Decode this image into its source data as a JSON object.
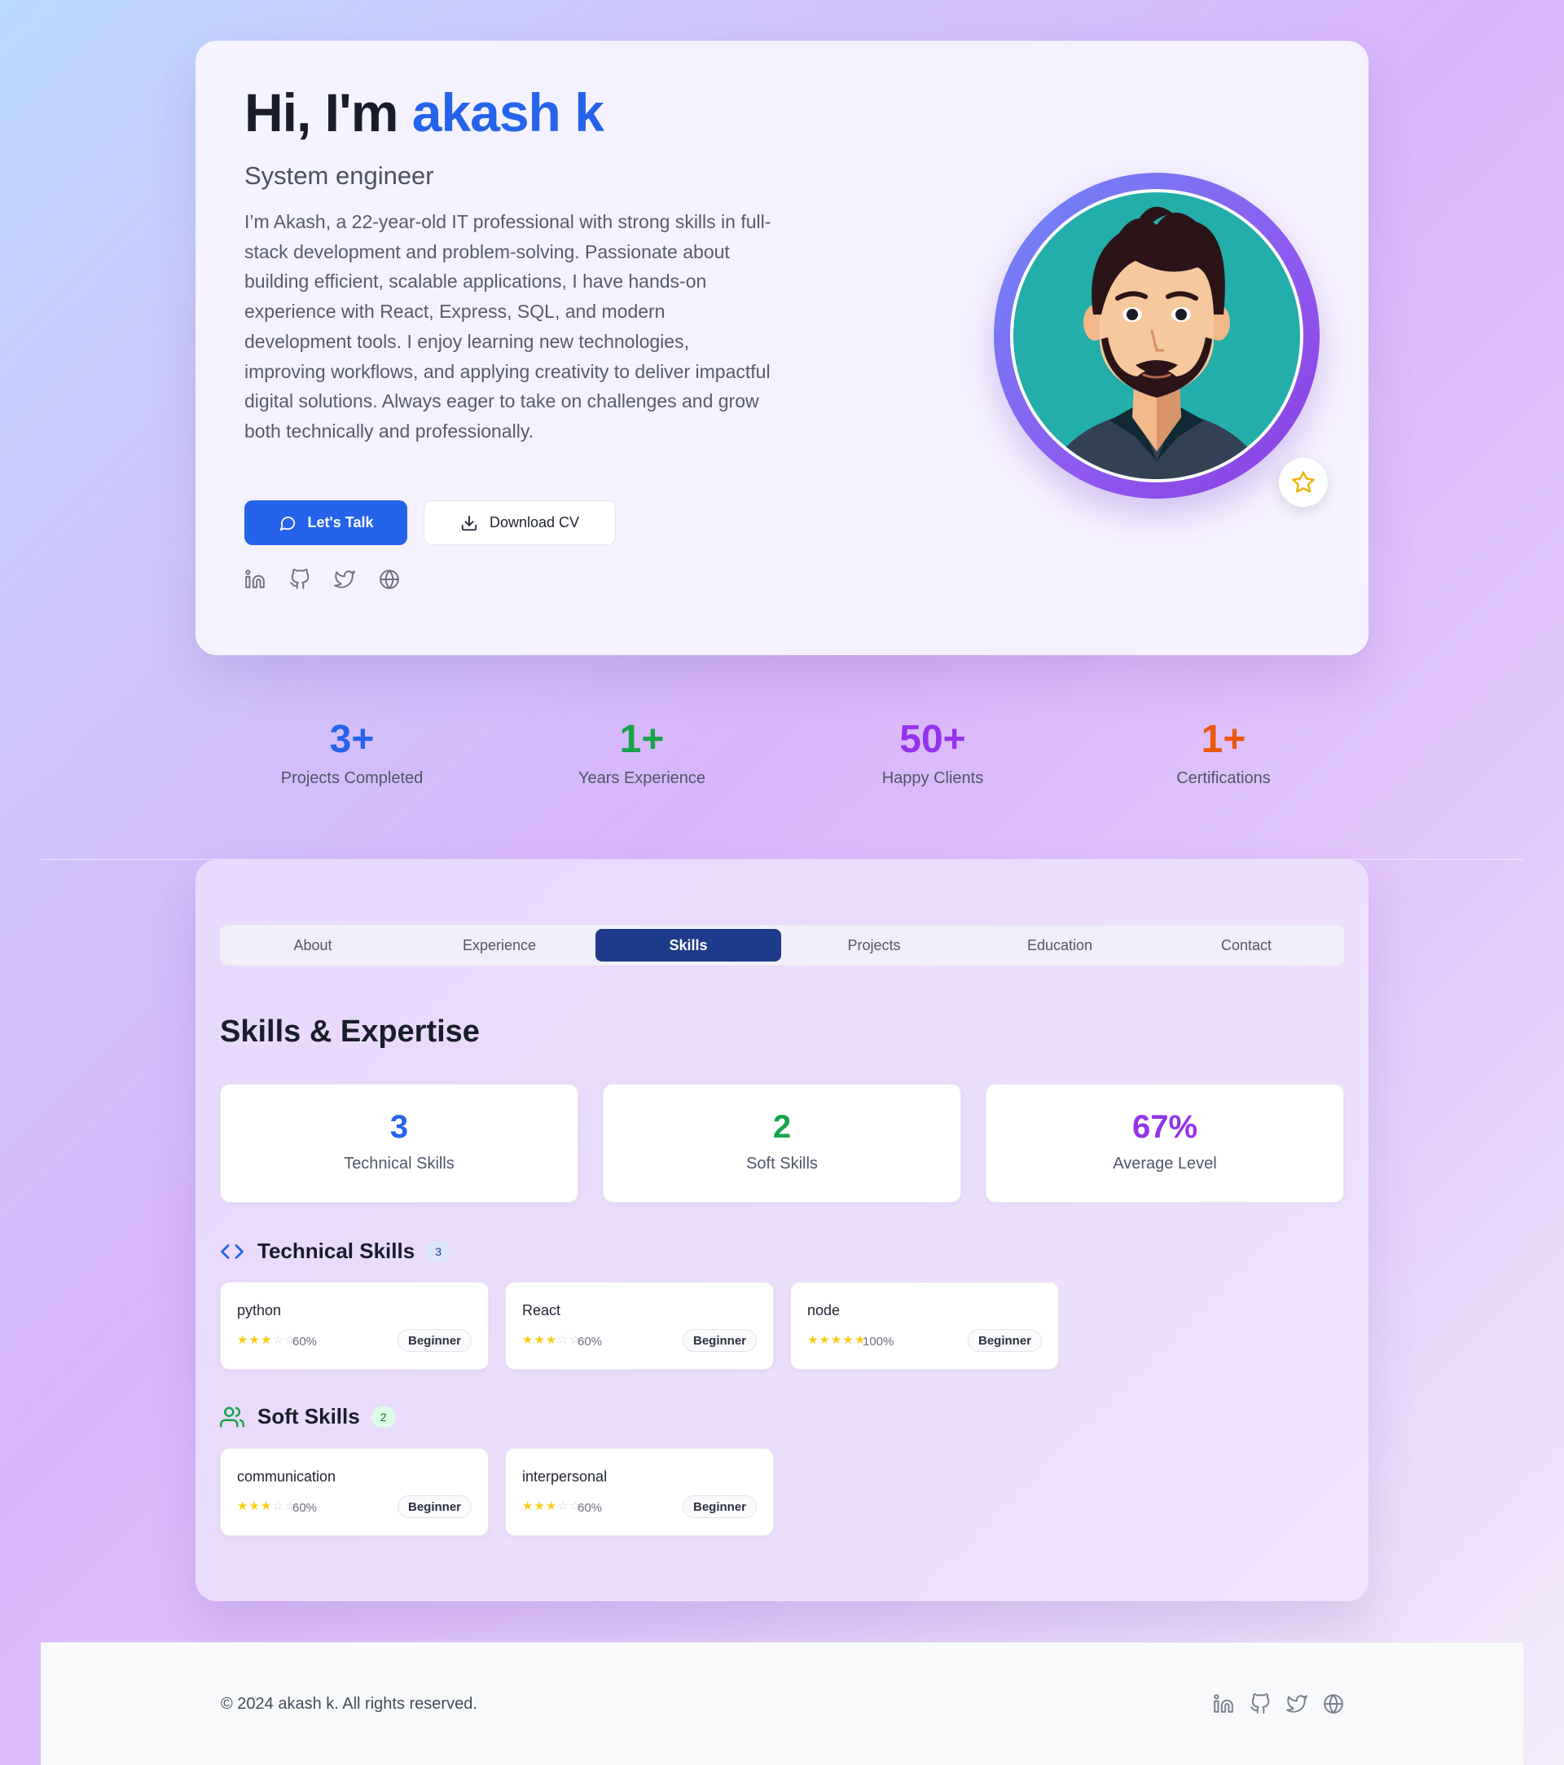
{
  "hero": {
    "greeting": "Hi, I'm ",
    "name": "akash k",
    "role": "System engineer",
    "description": "I’m Akash, a 22-year-old IT professional with strong skills in full-stack development and problem-solving. Passionate about building efficient, scalable applications, I have hands-on experience with React, Express, SQL, and modern development tools. I enjoy learning new technologies, improving workflows, and applying creativity to deliver impactful digital solutions. Always eager to take on challenges and grow both technically and professionally.",
    "primary_button": "Let's Talk",
    "secondary_button": "Download CV",
    "socials": [
      "linkedin-icon",
      "github-icon",
      "twitter-icon",
      "globe-icon"
    ]
  },
  "stats": [
    {
      "value": "3+",
      "label": "Projects Completed",
      "color": "#2563eb"
    },
    {
      "value": "1+",
      "label": "Years Experience",
      "color": "#16a34a"
    },
    {
      "value": "50+",
      "label": "Happy Clients",
      "color": "#9333ea"
    },
    {
      "value": "1+",
      "label": "Certifications",
      "color": "#ea580c"
    }
  ],
  "tabs": [
    {
      "label": "About",
      "active": false
    },
    {
      "label": "Experience",
      "active": false
    },
    {
      "label": "Skills",
      "active": true
    },
    {
      "label": "Projects",
      "active": false
    },
    {
      "label": "Education",
      "active": false
    },
    {
      "label": "Contact",
      "active": false
    }
  ],
  "skills": {
    "title": "Skills & Expertise",
    "summary": [
      {
        "value": "3",
        "label": "Technical Skills",
        "color": "#2563eb"
      },
      {
        "value": "2",
        "label": "Soft Skills",
        "color": "#16a34a"
      },
      {
        "value": "67%",
        "label": "Average Level",
        "color": "#9333ea"
      }
    ],
    "technical": {
      "title": "Technical Skills",
      "count": "3",
      "items": [
        {
          "name": "python",
          "stars": 3,
          "percent": "60%",
          "level": "Beginner"
        },
        {
          "name": "React",
          "stars": 3,
          "percent": "60%",
          "level": "Beginner"
        },
        {
          "name": "node",
          "stars": 5,
          "percent": "100%",
          "level": "Beginner"
        }
      ]
    },
    "soft": {
      "title": "Soft Skills",
      "count": "2",
      "items": [
        {
          "name": "communication",
          "stars": 3,
          "percent": "60%",
          "level": "Beginner"
        },
        {
          "name": "interpersonal",
          "stars": 3,
          "percent": "60%",
          "level": "Beginner"
        }
      ]
    }
  },
  "footer": {
    "copyright": "© 2024 akash k. All rights reserved."
  },
  "colors": {
    "accent": "#2563eb",
    "active_tab": "#1e3a8a",
    "star": "#facc15",
    "star_empty": "#cfd2da"
  }
}
